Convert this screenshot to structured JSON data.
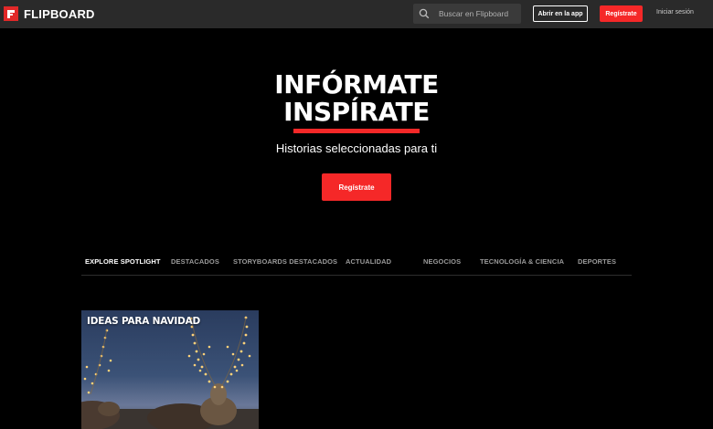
{
  "header": {
    "brand": "FLIPBOARD",
    "search_placeholder": "Buscar en Flipboard",
    "open_app_label": "Abrir en la app",
    "register_label": "Regístrate",
    "login_label": "Iniciar sesión"
  },
  "hero": {
    "title_line1": "INFÓRMATE",
    "title_line2": "INSPÍRATE",
    "subtitle": "Historias seleccionadas para ti",
    "cta_label": "Regístrate"
  },
  "tabs": [
    {
      "label": "EXPLORE SPOTLIGHT",
      "active": true
    },
    {
      "label": "DESTACADOS",
      "active": false
    },
    {
      "label": "STORYBOARDS DESTACADOS",
      "active": false
    },
    {
      "label": "ACTUALIDAD",
      "active": false
    },
    {
      "label": "NEGOCIOS",
      "active": false
    },
    {
      "label": "TECNOLOGÍA & CIENCIA",
      "active": false
    },
    {
      "label": "DEPORTES",
      "active": false
    }
  ],
  "cards": [
    {
      "title": "IDEAS PARA NAVIDAD"
    }
  ],
  "colors": {
    "accent": "#f52828",
    "topbar": "#2a2a2a",
    "background": "#000000"
  }
}
